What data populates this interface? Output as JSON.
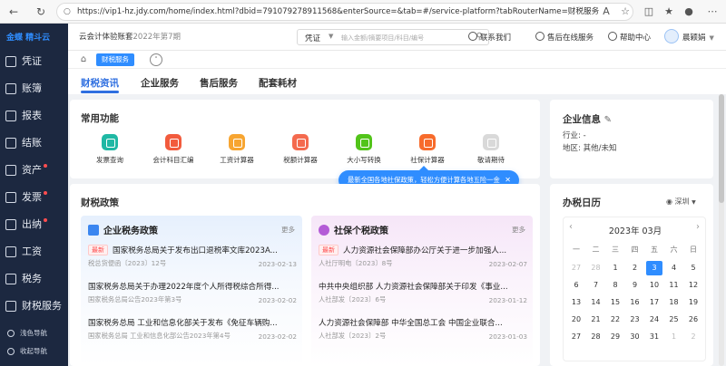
{
  "browser": {
    "url": "https://vip1-hz.jdy.com/home/index.html?dbid=791079278911568&enterSource=&tab=#/service-platform?tabRouterName=财税服务"
  },
  "sidebar": {
    "logo": "金蝶 精斗云",
    "items": [
      {
        "label": "凭证",
        "dot": false
      },
      {
        "label": "账簿",
        "dot": false
      },
      {
        "label": "报表",
        "dot": false
      },
      {
        "label": "结账",
        "dot": false
      },
      {
        "label": "资产",
        "dot": true
      },
      {
        "label": "发票",
        "dot": true
      },
      {
        "label": "出纳",
        "dot": true
      },
      {
        "label": "工资",
        "dot": false
      },
      {
        "label": "税务",
        "dot": false
      },
      {
        "label": "财税服务",
        "dot": false
      }
    ],
    "footer": [
      "浅色导航",
      "收起导航"
    ]
  },
  "header": {
    "title": "云会计体验账套",
    "period": "2022年第7期",
    "search_type": "凭证",
    "search_placeholder": "输入金额/摘要项目/科目/编号",
    "links": [
      "联系我们",
      "售后在线服务",
      "帮助中心"
    ],
    "user": "晨颖娟"
  },
  "tabs": {
    "page_tab": "财税服务"
  },
  "main_tabs": [
    "财税资讯",
    "企业服务",
    "售后服务",
    "配套耗材"
  ],
  "common_functions": {
    "title": "常用功能",
    "items": [
      {
        "label": "发票查询",
        "color": "#1fb8a4"
      },
      {
        "label": "会计科目汇编",
        "color": "#f25b3d"
      },
      {
        "label": "工资计算器",
        "color": "#f7a531"
      },
      {
        "label": "税额计算器",
        "color": "#f46a4e"
      },
      {
        "label": "大小写转换",
        "color": "#52c41a"
      },
      {
        "label": "社保计算器",
        "color": "#f76b2b"
      },
      {
        "label": "敬请期待",
        "color": "#d9d9d9"
      }
    ],
    "tooltip": "最新全国各地社保政策，轻松方便计算各地五险一金"
  },
  "company": {
    "title": "企业信息",
    "industry_label": "行业:",
    "industry_value": "-",
    "region_label": "地区:",
    "region_value": "其他/未知"
  },
  "tax_policy": {
    "title": "财税政策",
    "enterprise": {
      "title": "企业税务政策",
      "more": "更多",
      "news": [
        {
          "tag": "最新",
          "title": "国家税务总局关于发布出口退税率文库2023A...",
          "source": "税总货便函〔2023〕12号",
          "date": "2023-02-13"
        },
        {
          "tag": "",
          "title": "国家税务总局关于办理2022年度个人所得税综合所得...",
          "source": "国家税务总局公告2023年第3号",
          "date": "2023-02-02"
        },
        {
          "tag": "",
          "title": "国家税务总局 工业和信息化部关于发布《免征车辆购...",
          "source": "国家税务总局 工业和信息化部公告2023年第4号",
          "date": "2023-02-02"
        }
      ]
    },
    "social": {
      "title": "社保个税政策",
      "more": "更多",
      "news": [
        {
          "tag": "最新",
          "title": "人力资源社会保障部办公厅关于进一步加强人...",
          "source": "人社厅明电〔2023〕8号",
          "date": "2023-02-07"
        },
        {
          "tag": "",
          "title": "中共中央组织部 人力资源社会保障部关于印发《事业...",
          "source": "人社部发〔2023〕6号",
          "date": "2023-01-12"
        },
        {
          "tag": "",
          "title": "人力资源社会保障部 中华全国总工会 中国企业联合...",
          "source": "人社部发〔2023〕2号",
          "date": "2023-01-03"
        }
      ]
    }
  },
  "calendar": {
    "title": "办税日历",
    "city": "深圳",
    "month": "2023年 03月",
    "weekdays": [
      "一",
      "二",
      "三",
      "四",
      "五",
      "六",
      "日"
    ],
    "selected_day": "3",
    "rows": [
      [
        {
          "d": "27",
          "m": true
        },
        {
          "d": "28",
          "m": true
        },
        {
          "d": "1",
          "m": false
        },
        {
          "d": "2",
          "m": false
        },
        {
          "d": "3",
          "m": false
        },
        {
          "d": "4",
          "m": false
        },
        {
          "d": "5",
          "m": false
        }
      ],
      [
        {
          "d": "6",
          "m": false
        },
        {
          "d": "7",
          "m": false
        },
        {
          "d": "8",
          "m": false
        },
        {
          "d": "9",
          "m": false
        },
        {
          "d": "10",
          "m": false
        },
        {
          "d": "11",
          "m": false
        },
        {
          "d": "12",
          "m": false
        }
      ],
      [
        {
          "d": "13",
          "m": false
        },
        {
          "d": "14",
          "m": false
        },
        {
          "d": "15",
          "m": false
        },
        {
          "d": "16",
          "m": false
        },
        {
          "d": "17",
          "m": false
        },
        {
          "d": "18",
          "m": false
        },
        {
          "d": "19",
          "m": false
        }
      ],
      [
        {
          "d": "20",
          "m": false
        },
        {
          "d": "21",
          "m": false
        },
        {
          "d": "22",
          "m": false
        },
        {
          "d": "23",
          "m": false
        },
        {
          "d": "24",
          "m": false
        },
        {
          "d": "25",
          "m": false
        },
        {
          "d": "26",
          "m": false
        }
      ],
      [
        {
          "d": "27",
          "m": false
        },
        {
          "d": "28",
          "m": false
        },
        {
          "d": "29",
          "m": false
        },
        {
          "d": "30",
          "m": false
        },
        {
          "d": "31",
          "m": false
        },
        {
          "d": "1",
          "m": true
        },
        {
          "d": "2",
          "m": true
        }
      ]
    ]
  },
  "colors": {
    "accent": "#2f8dff",
    "active_tab": "#2f6fe0",
    "sidebar_bg": "#1c2840"
  }
}
